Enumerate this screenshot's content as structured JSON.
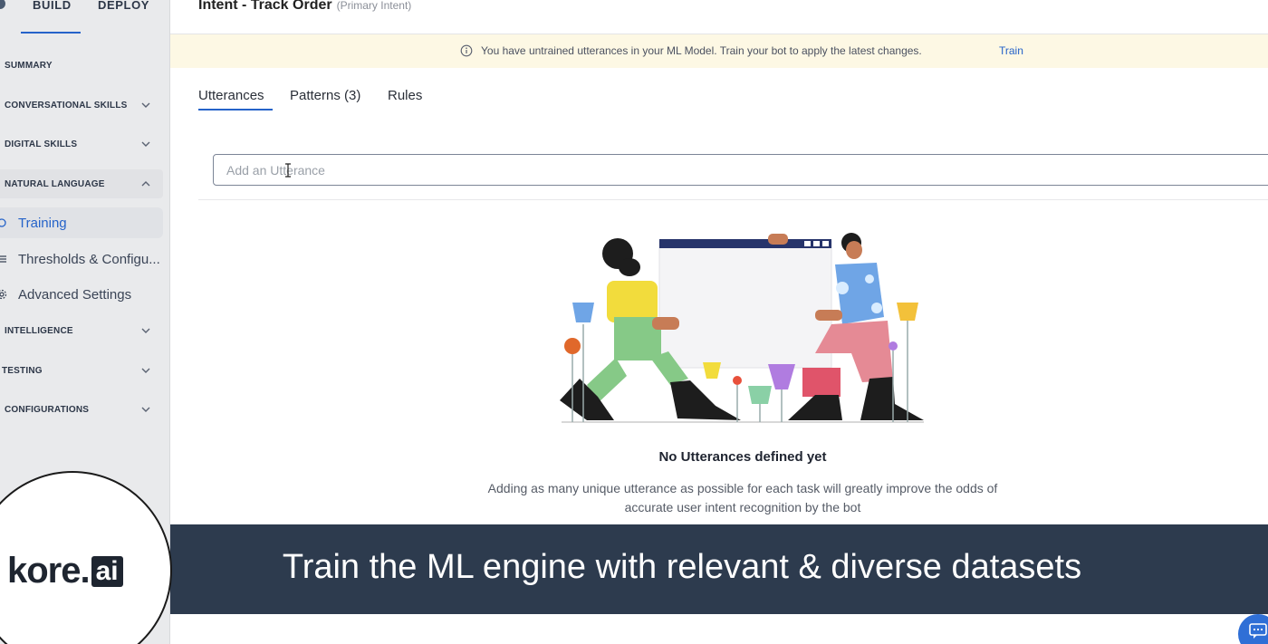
{
  "topnav": {
    "build": "BUILD",
    "deploy": "DEPLOY"
  },
  "header": {
    "title": "Intent - Track Order",
    "subtitle": "(Primary Intent)"
  },
  "sidebar": {
    "summary": "SUMMARY",
    "conversational_skills": "CONVERSATIONAL SKILLS",
    "digital_skills": "DIGITAL SKILLS",
    "natural_language": "NATURAL LANGUAGE",
    "items": [
      {
        "label": "Training"
      },
      {
        "label": "Thresholds & Configu..."
      },
      {
        "label": "Advanced Settings"
      }
    ],
    "intelligence": "INTELLIGENCE",
    "testing": "TESTING",
    "configurations": "CONFIGURATIONS"
  },
  "banner": {
    "message": "You have untrained utterances in your ML Model. Train your bot to apply the latest changes.",
    "action": "Train"
  },
  "tabs": {
    "utterances": "Utterances",
    "patterns": "Patterns (3)",
    "rules": "Rules"
  },
  "utterance_input": {
    "placeholder": "Add an Utterance"
  },
  "empty_state": {
    "title": "No Utterances defined yet",
    "line1": "Adding as many unique utterance as possible for each task will greatly improve the odds of",
    "line2": "accurate user intent recognition by the bot"
  },
  "caption": "Train the ML engine with relevant & diverse datasets",
  "logo": {
    "kore": "kore.",
    "ai": "ai"
  },
  "colors": {
    "accent": "#2563c9",
    "banner_bg": "#fdf8e4",
    "caption_bg": "#2d3b4e",
    "sidebar_bg": "#e9eaec"
  }
}
